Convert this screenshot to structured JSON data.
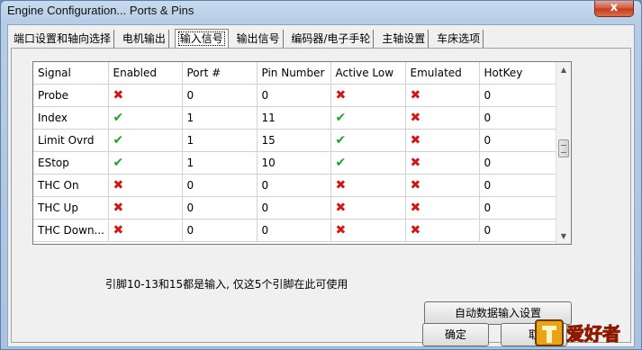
{
  "window": {
    "title": "Engine Configuration... Ports & Pins",
    "close_label": "x"
  },
  "tabs": [
    {
      "label": "端口设置和轴向选择",
      "active": false
    },
    {
      "label": "电机输出",
      "active": false
    },
    {
      "label": "输入信号",
      "active": true
    },
    {
      "label": "输出信号",
      "active": false
    },
    {
      "label": "编码器/电子手轮",
      "active": false
    },
    {
      "label": "主轴设置",
      "active": false
    },
    {
      "label": "车床选项",
      "active": false
    }
  ],
  "table": {
    "columns": [
      "Signal",
      "Enabled",
      "Port #",
      "Pin Number",
      "Active Low",
      "Emulated",
      "HotKey"
    ],
    "rows": [
      {
        "signal": "Probe",
        "enabled": false,
        "port": "0",
        "pin": "0",
        "active_low": false,
        "emulated": false,
        "hotkey": "0"
      },
      {
        "signal": "Index",
        "enabled": true,
        "port": "1",
        "pin": "11",
        "active_low": true,
        "emulated": false,
        "hotkey": "0"
      },
      {
        "signal": "Limit Ovrd",
        "enabled": true,
        "port": "1",
        "pin": "15",
        "active_low": true,
        "emulated": false,
        "hotkey": "0"
      },
      {
        "signal": "EStop",
        "enabled": true,
        "port": "1",
        "pin": "10",
        "active_low": true,
        "emulated": false,
        "hotkey": "0"
      },
      {
        "signal": "THC On",
        "enabled": false,
        "port": "0",
        "pin": "0",
        "active_low": false,
        "emulated": false,
        "hotkey": "0"
      },
      {
        "signal": "THC Up",
        "enabled": false,
        "port": "0",
        "pin": "0",
        "active_low": false,
        "emulated": false,
        "hotkey": "0"
      },
      {
        "signal": "THC Down...",
        "enabled": false,
        "port": "0",
        "pin": "0",
        "active_low": false,
        "emulated": false,
        "hotkey": "0"
      }
    ]
  },
  "note": "引脚10-13和15都是输入, 仅这5个引脚在此可使用",
  "buttons": {
    "auto_setup": "自动数据输入设置",
    "ok": "确定",
    "cancel": "取"
  },
  "icons": {
    "enabled_true": "✔",
    "enabled_false": "✖"
  },
  "colors": {
    "check": "#22a22a",
    "cross": "#d01818"
  },
  "logo": {
    "text": "爱好者"
  }
}
